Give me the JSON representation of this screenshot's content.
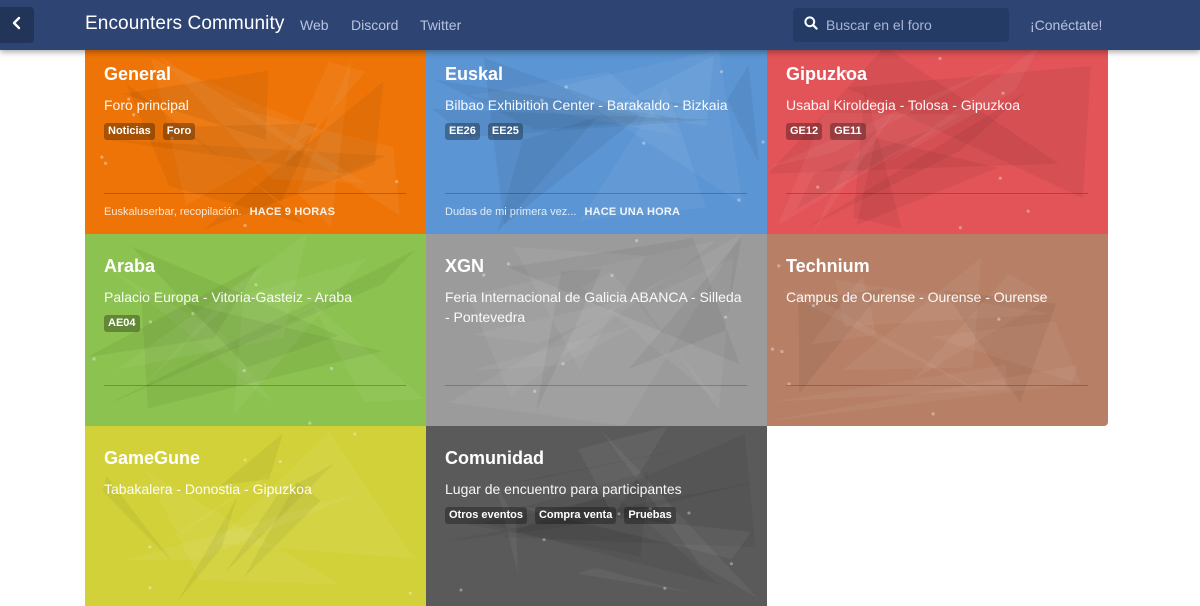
{
  "header": {
    "brand": "Encounters Community",
    "nav": [
      "Web",
      "Discord",
      "Twitter"
    ],
    "search_placeholder": "Buscar en el foro",
    "login_label": "¡Conéctate!"
  },
  "tiles": [
    {
      "title": "General",
      "description": "Foro principal",
      "tags": [
        "Noticias",
        "Foro"
      ],
      "last_post": "Euskaluserbar, recopilación.",
      "last_time": "HACE 9 HORAS",
      "color": "#ee7407"
    },
    {
      "title": "Euskal",
      "description": "Bilbao Exhibition Center - Barakaldo - Bizkaia",
      "tags": [
        "EE26",
        "EE25"
      ],
      "last_post": "Dudas de mi primera vez...",
      "last_time": "HACE UNA HORA",
      "color": "#5b95d3"
    },
    {
      "title": "Gipuzkoa",
      "description": "Usabal Kiroldegia - Tolosa - Gipuzkoa",
      "tags": [
        "GE12",
        "GE11"
      ],
      "last_post": "",
      "last_time": "",
      "color": "#e25458"
    },
    {
      "title": "Araba",
      "description": "Palacio Europa - Vitoria-Gasteiz - Araba",
      "tags": [
        "AE04"
      ],
      "last_post": "",
      "last_time": "",
      "color": "#8cc250"
    },
    {
      "title": "XGN",
      "description": "Feria Internacional de Galicia ABANCA - Silleda - Pontevedra",
      "tags": [],
      "last_post": "",
      "last_time": "",
      "color": "#9b9b9b"
    },
    {
      "title": "Technium",
      "description": "Campus de Ourense - Ourense - Ourense",
      "tags": [],
      "last_post": "",
      "last_time": "",
      "color": "#b77f66"
    },
    {
      "title": "GameGune",
      "description": "Tabakalera - Donostia - Gipuzkoa",
      "tags": [],
      "last_post": "",
      "last_time": "",
      "color": "#d2d13a"
    },
    {
      "title": "Comunidad",
      "description": "Lugar de encuentro para participantes",
      "tags": [
        "Otros eventos",
        "Compra venta",
        "Pruebas"
      ],
      "last_post": "",
      "last_time": "",
      "color": "#5a5a5a"
    }
  ],
  "icons": {
    "back": "chevron-left-icon",
    "search": "search-icon"
  }
}
